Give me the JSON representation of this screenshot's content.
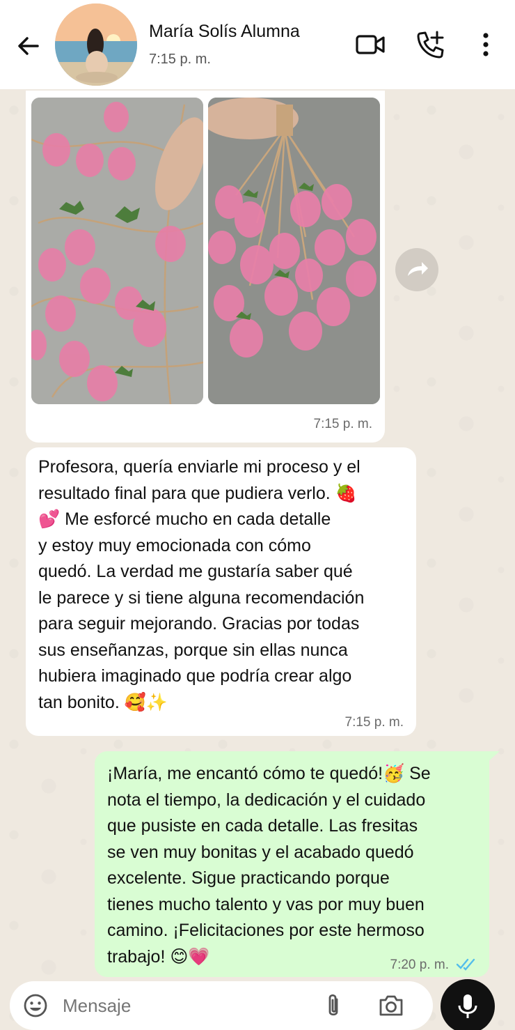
{
  "header": {
    "contact_name": "María Solís Alumna",
    "status": "7:15 p. m.",
    "icons": [
      "back-arrow-icon",
      "video-call-icon",
      "add-call-icon",
      "more-vert-icon"
    ]
  },
  "messages": [
    {
      "type": "images",
      "direction": "incoming",
      "image_count": 2,
      "time": "7:15 p. m."
    },
    {
      "type": "text",
      "direction": "incoming",
      "text": "Profesora, quería enviarle mi proceso y el\nresultado final para que pudiera verlo. 🍓\n💕 Me esforcé mucho en cada detalle\ny estoy muy emocionada con cómo\nquedó. La verdad me gustaría saber qué\nle parece y si tiene alguna recomendación\npara seguir mejorando. Gracias por todas\nsus enseñanzas, porque sin ellas nunca\nhubiera imaginado que podría crear algo\ntan bonito. 🥰✨",
      "time": "7:15 p. m."
    },
    {
      "type": "text",
      "direction": "outgoing",
      "text": "¡María, me encantó cómo te quedó!🥳 Se\nnota el tiempo, la dedicación y el cuidado\nque pusiste en cada detalle. Las fresitas\nse ven muy bonitas y el acabado quedó\nexcelente. Sigue practicando porque\ntienes mucho talento y vas por muy buen\ncamino. ¡Felicitaciones por este hermoso\ntrabajo! 😊💗",
      "time": "7:20 p. m.",
      "read_status": "read"
    }
  ],
  "input": {
    "placeholder": "Mensaje"
  },
  "colors": {
    "header_bg": "#ffffff",
    "chat_bg": "#efeae2",
    "incoming_bubble": "#ffffff",
    "outgoing_bubble": "#d9fdd3",
    "read_ticks": "#53bdeb",
    "mic_button": "#111111"
  }
}
